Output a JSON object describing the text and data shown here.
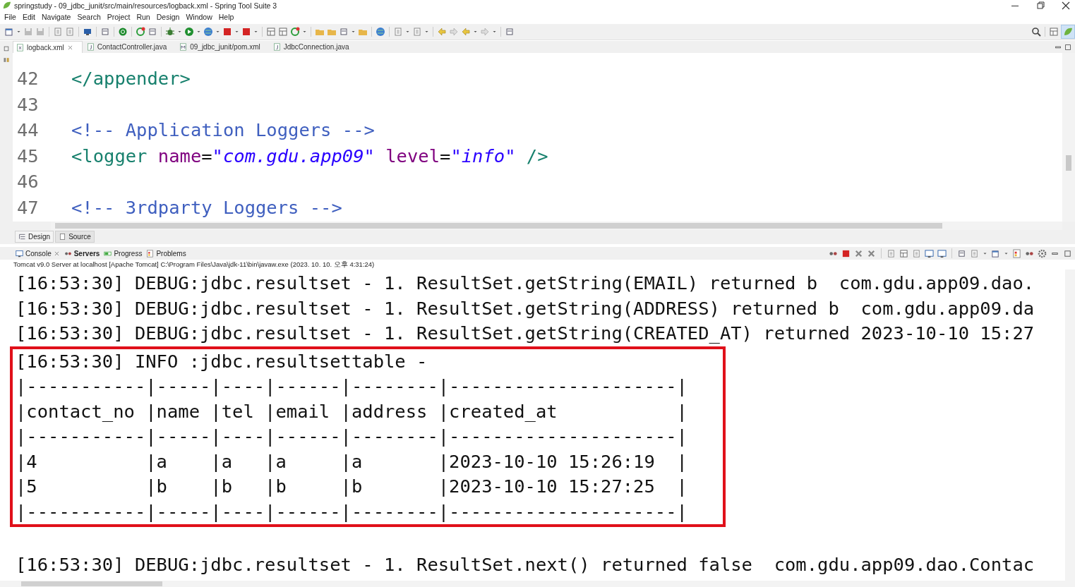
{
  "window": {
    "title": "springstudy - 09_jdbc_junit/src/main/resources/logback.xml - Spring Tool Suite 3"
  },
  "menu": [
    "File",
    "Edit",
    "Navigate",
    "Search",
    "Project",
    "Run",
    "Design",
    "Window",
    "Help"
  ],
  "editor_tabs": [
    {
      "label": "logback.xml",
      "selected": true,
      "closable": true
    },
    {
      "label": "ContactController.java",
      "selected": false,
      "closable": false
    },
    {
      "label": "09_jdbc_junit/pom.xml",
      "selected": false,
      "closable": false
    },
    {
      "label": "JdbcConnection.java",
      "selected": false,
      "closable": false
    }
  ],
  "editor": {
    "lines": [
      {
        "number": "42",
        "segments": [
          {
            "kind": "tag",
            "text": "</appender>"
          }
        ]
      },
      {
        "number": "43"
      },
      {
        "number": "44",
        "segments": [
          {
            "kind": "comment",
            "text": "<!-- Application Loggers -->"
          }
        ]
      },
      {
        "number": "45",
        "segments": [
          {
            "kind": "tag",
            "text": "<logger "
          },
          {
            "kind": "attr",
            "text": "name"
          },
          {
            "kind": "plain",
            "text": "="
          },
          {
            "kind": "string",
            "text": "\"com.gdu.app09\" "
          },
          {
            "kind": "attr",
            "text": "level"
          },
          {
            "kind": "plain",
            "text": "="
          },
          {
            "kind": "string",
            "text": "\"info\""
          },
          {
            "kind": "tag",
            "text": " />"
          }
        ]
      },
      {
        "number": "46"
      },
      {
        "number": "47",
        "segments": [
          {
            "kind": "comment",
            "text": "<!-- 3rdparty Loggers -->"
          }
        ]
      }
    ]
  },
  "editor_mode_tabs": [
    {
      "label": "Design",
      "selected": false
    },
    {
      "label": "Source",
      "selected": true
    }
  ],
  "console_tabs": [
    {
      "label": "Console",
      "selected": false,
      "closable": true
    },
    {
      "label": "Servers",
      "selected": true,
      "closable": false
    },
    {
      "label": "Progress",
      "selected": false,
      "closable": false
    },
    {
      "label": "Problems",
      "selected": false,
      "closable": false
    }
  ],
  "console": {
    "process": "Tomcat v9.0 Server at localhost [Apache Tomcat] C:\\Program Files\\Java\\jdk-11\\bin\\javaw.exe  (2023. 10. 10. 오후 4:31:24)",
    "lines": [
      {
        "text": "[16:53:30] DEBUG:jdbc.resultset - 1. ResultSet.getString(EMAIL) returned b  com.gdu.app09.dao.",
        "highlighted": false
      },
      {
        "text": "[16:53:30] DEBUG:jdbc.resultset - 1. ResultSet.getString(ADDRESS) returned b  com.gdu.app09.da",
        "highlighted": false
      },
      {
        "text": "[16:53:30] DEBUG:jdbc.resultset - 1. ResultSet.getString(CREATED_AT) returned 2023-10-10 15:27",
        "highlighted": false
      },
      {
        "text": "[16:53:30] INFO :jdbc.resultsettable - ",
        "highlighted": true
      },
      {
        "text": "|-----------|-----|----|------|--------|---------------------|",
        "highlighted": true
      },
      {
        "text": "|contact_no |name |tel |email |address |created_at           |",
        "highlighted": true
      },
      {
        "text": "|-----------|-----|----|------|--------|---------------------|",
        "highlighted": true
      },
      {
        "text": "|4          |a    |a   |a     |a       |2023-10-10 15:26:19  |",
        "highlighted": true
      },
      {
        "text": "|5          |b    |b   |b     |b       |2023-10-10 15:27:25  |",
        "highlighted": true
      },
      {
        "text": "|-----------|-----|----|------|--------|---------------------|",
        "highlighted": true
      },
      {
        "highlighted": false
      },
      {
        "text": "[16:53:30] DEBUG:jdbc.resultset - 1. ResultSet.next() returned false  com.gdu.app09.dao.Contac",
        "highlighted": false
      }
    ]
  }
}
